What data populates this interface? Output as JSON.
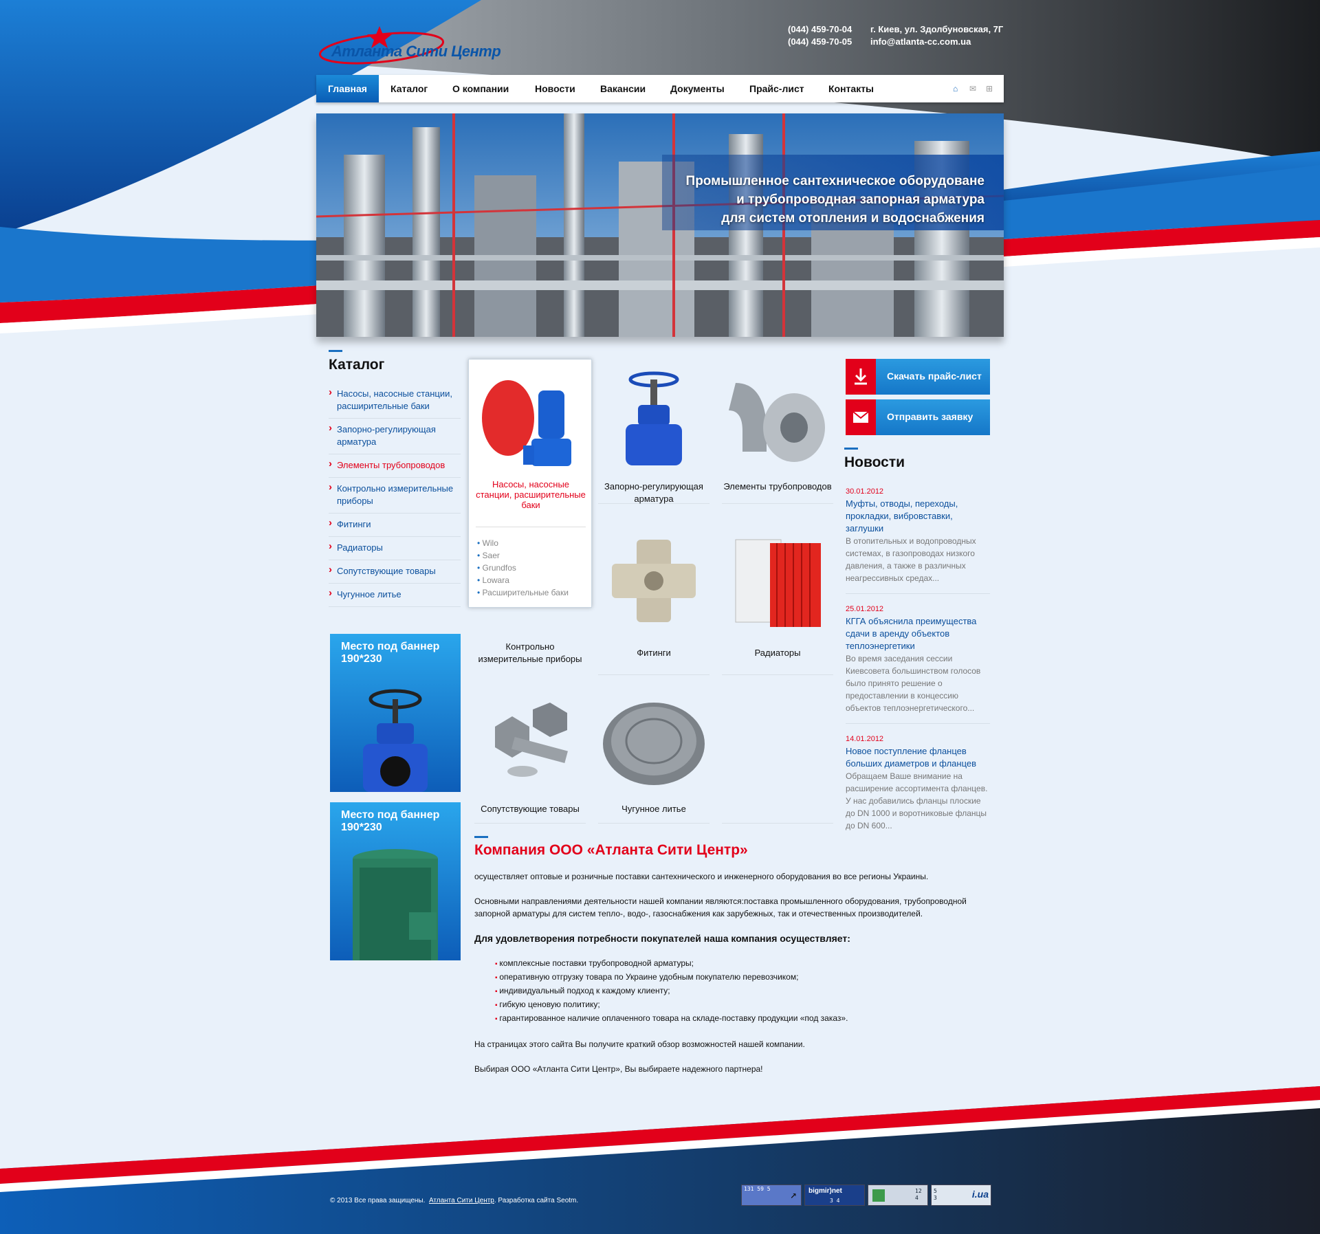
{
  "header": {
    "logo_text": "Атланта Сити Центр",
    "phone1": "(044) 459-70-04",
    "phone2": "(044) 459-70-05",
    "address": "г. Киев, ул. Здолбуновская, 7Г",
    "email": "info@atlanta-cc.com.ua"
  },
  "nav": {
    "items": [
      {
        "label": "Главная"
      },
      {
        "label": "Каталог"
      },
      {
        "label": "О компании"
      },
      {
        "label": "Новости"
      },
      {
        "label": "Вакансии"
      },
      {
        "label": "Документы"
      },
      {
        "label": "Прайс-лист"
      },
      {
        "label": "Контакты"
      }
    ],
    "icons": [
      "home-icon",
      "mail-icon",
      "sitemap-icon"
    ]
  },
  "hero": {
    "line1": "Промышленное сантехническое оборудоване",
    "line2": "и трубопроводная запорная арматура",
    "line3": "для систем отопления и водоснабжения"
  },
  "sidebar": {
    "title": "Каталог",
    "items": [
      {
        "label": "Насосы, насосные станции, расширительные баки"
      },
      {
        "label": "Запорно-регулирующая арматура"
      },
      {
        "label": "Элементы трубопроводов"
      },
      {
        "label": "Контрольно измерительные приборы"
      },
      {
        "label": "Фитинги"
      },
      {
        "label": "Радиаторы"
      },
      {
        "label": "Сопутствующие товары"
      },
      {
        "label": "Чугунное литье"
      }
    ],
    "banner1": "Место под баннер 190*230",
    "banner2": "Место под баннер 190*230"
  },
  "products": {
    "p1": "Насосы, насосные станции, расширительные баки",
    "p1_brands": [
      "Wilo",
      "Saer",
      "Grundfos",
      "Lowara",
      "Расширительные баки"
    ],
    "p2": "Запорно-регулирующая арматура",
    "p3": "Элементы трубопроводов",
    "p4": "Контрольно измерительные приборы",
    "p5": "Фитинги",
    "p6": "Радиаторы",
    "p7": "Сопутствующие товары",
    "p8": "Чугунное литье"
  },
  "buttons": {
    "price": "Скачать прайс-лист",
    "order": "Отправить заявку"
  },
  "news": {
    "title": "Новости",
    "items": [
      {
        "date": "30.01.2012",
        "title": "Муфты, отводы, переходы, прокладки, вибровставки, заглушки",
        "text": "В отопительных и водопроводных системах, в газопроводах низкого давления, а также в различных неагрессивных средах..."
      },
      {
        "date": "25.01.2012",
        "title": "КГГА объяснила преимущества сдачи в аренду объектов теплоэнергетики",
        "text": "Во время заседания сессии Киевсовета большинством голосов было принято решение о предоставлении в концессию объектов теплоэнергетического..."
      },
      {
        "date": "14.01.2012",
        "title": "Новое поступление фланцев больших диаметров и фланцев",
        "text": "Обращаем Ваше внимание на расширение ассортимента фланцев. У нас добавились фланцы плоские до DN 1000 и воротниковые фланцы до DN 600..."
      }
    ]
  },
  "about": {
    "title": "Компания ООО «Атланта Сити Центр»",
    "p1": "осуществляет оптовые и розничные поставки сантехнического и инженерного оборудования во все регионы Украины.",
    "p2": "Основными направлениями деятельности нашей компании являются:поставка промышленного оборудования, трубопроводной запорной арматуры для систем тепло-, водо-, газоснабжения как зарубежных, так и отечественных производителей.",
    "p3": "Для удовлетворения потребности покупателей наша компания осуществляет:",
    "list": [
      "комплексные поставки трубопроводной арматуры;",
      "оперативную отгрузку товара по Украине удобным покупателю перевозчиком;",
      "индивидуальный подход к каждому клиенту;",
      "гибкую ценовую политику;",
      "гарантированное наличие оплаченного товара на складе-поставку продукции «под заказ»."
    ],
    "p4": "На страницах этого сайта Вы получите краткий обзор возможностей нашей компании.",
    "p5": "Выбирая ООО «Атланта Сити Центр», Вы выбираете надежного партнера!"
  },
  "footer": {
    "copy_pre": "© 2013 Все права защищены.",
    "copy_link": "Атланта Сити Центр",
    "copy_post": ". Разработка сайта Seotm.",
    "counter1": "131 59 5",
    "counter2_brand": "bigmir)net",
    "counter2_nums": "3  4",
    "counter3_nums": "12 4",
    "counter4_nums": "5 3",
    "counter4_brand": "i.ua"
  },
  "colors": {
    "accent_red": "#e2001a",
    "brand_blue": "#0b4f9c",
    "nav_active": "#1577c8"
  }
}
